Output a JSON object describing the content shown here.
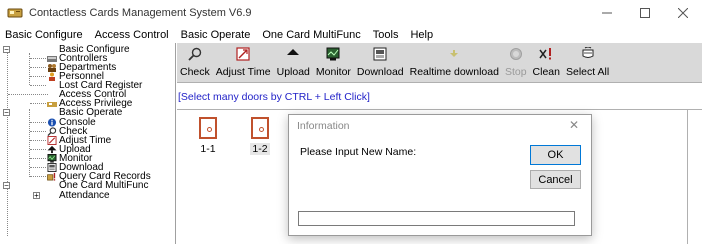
{
  "window": {
    "title": "Contactless Cards Management System  V6.9",
    "controls": [
      "minimize-icon",
      "maximize-icon",
      "close-icon"
    ]
  },
  "menubar": {
    "items": [
      {
        "label": "Basic Configure"
      },
      {
        "label": "Access Control"
      },
      {
        "label": "Basic Operate"
      },
      {
        "label": "One Card MultiFunc"
      },
      {
        "label": "Tools"
      },
      {
        "label": "Help"
      }
    ]
  },
  "tree": {
    "items": [
      {
        "label": "Basic Configure",
        "level": 0,
        "expander": "−",
        "icon": null
      },
      {
        "label": "Controllers",
        "level": 1,
        "icon": "controllers-icon"
      },
      {
        "label": "Departments",
        "level": 1,
        "icon": "departments-icon"
      },
      {
        "label": "Personnel",
        "level": 1,
        "icon": "personnel-icon"
      },
      {
        "label": "Lost Card Register",
        "level": 1,
        "icon": null
      },
      {
        "label": "Access Control",
        "level": 0,
        "expander": "−",
        "icon": null
      },
      {
        "label": "Access Privilege",
        "level": 1,
        "icon": "access-privilege-icon"
      },
      {
        "label": "Basic Operate",
        "level": 0,
        "expander": "−",
        "icon": null
      },
      {
        "label": "Console",
        "level": 1,
        "icon": "console-icon"
      },
      {
        "label": "Check",
        "level": 1,
        "icon": "check-icon"
      },
      {
        "label": "Adjust Time",
        "level": 1,
        "icon": "adjust-time-icon"
      },
      {
        "label": "Upload",
        "level": 1,
        "icon": "upload-icon"
      },
      {
        "label": "Monitor",
        "level": 1,
        "icon": "monitor-icon"
      },
      {
        "label": "Download",
        "level": 1,
        "icon": "download-icon"
      },
      {
        "label": "Query Card Records",
        "level": 1,
        "icon": "query-records-icon"
      },
      {
        "label": "One Card MultiFunc",
        "level": 0,
        "expander": "−",
        "icon": null
      },
      {
        "label": "Attendance",
        "level": 1,
        "expander": "+",
        "icon": null
      }
    ]
  },
  "toolbar": {
    "buttons": [
      {
        "label": "Check",
        "icon": "check-icon",
        "enabled": true
      },
      {
        "label": "Adjust Time",
        "icon": "adjust-time-icon",
        "enabled": true
      },
      {
        "label": "Upload",
        "icon": "upload-icon",
        "enabled": true
      },
      {
        "label": "Monitor",
        "icon": "monitor-icon",
        "enabled": true
      },
      {
        "label": "Download",
        "icon": "download-icon",
        "enabled": true
      },
      {
        "label": "Realtime download",
        "icon": "realtime-download-icon",
        "enabled": true
      },
      {
        "label": "Stop",
        "icon": "stop-icon",
        "enabled": false
      },
      {
        "label": "Clean",
        "icon": "clean-icon",
        "enabled": true
      },
      {
        "label": "Select All",
        "icon": "select-all-icon",
        "enabled": true
      }
    ]
  },
  "hint": "[Select many doors by CTRL + Left Click]",
  "doors": [
    {
      "label": "1-1",
      "selected": false
    },
    {
      "label": "1-2",
      "selected": true
    }
  ],
  "dialog": {
    "title": "Information",
    "prompt": "Please Input New Name:",
    "ok_label": "OK",
    "cancel_label": "Cancel",
    "input_value": ""
  },
  "colors": {
    "toolbar_bg": "#d9d9d9",
    "hint_text": "#2323c8",
    "door_icon": "#c0512d",
    "ok_border": "#0078d7"
  }
}
